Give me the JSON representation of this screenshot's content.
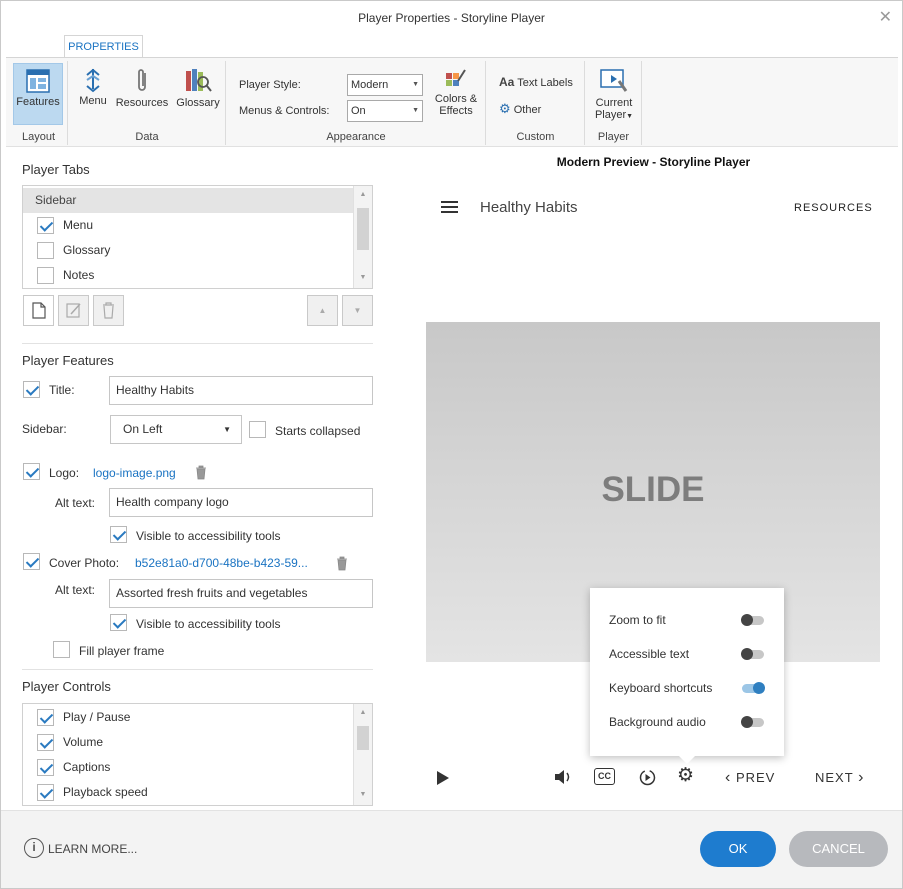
{
  "window": {
    "title": "Player Properties - Storyline Player"
  },
  "ribbon": {
    "tab": "PROPERTIES",
    "layout": {
      "features": "Features",
      "group": "Layout"
    },
    "data": {
      "menu": "Menu",
      "resources": "Resources",
      "glossary": "Glossary",
      "group": "Data"
    },
    "appearance": {
      "player_style_label": "Player Style:",
      "player_style_value": "Modern",
      "menus_controls_label": "Menus & Controls:",
      "menus_controls_value": "On",
      "colors_effects_line1": "Colors &",
      "colors_effects_line2": "Effects",
      "group": "Appearance"
    },
    "custom": {
      "text_labels_prefix": "Aa",
      "text_labels": "Text Labels",
      "other": "Other",
      "group": "Custom"
    },
    "player": {
      "current_line1": "Current",
      "current_line2": "Player",
      "group": "Player"
    }
  },
  "player_tabs": {
    "title": "Player Tabs",
    "header": "Sidebar",
    "items": [
      {
        "label": "Menu",
        "checked": true
      },
      {
        "label": "Glossary",
        "checked": false
      },
      {
        "label": "Notes",
        "checked": false
      }
    ]
  },
  "player_features": {
    "title": "Player Features",
    "title_label": "Title:",
    "title_value": "Healthy Habits",
    "sidebar_label": "Sidebar:",
    "sidebar_value": "On Left",
    "starts_collapsed": "Starts collapsed",
    "logo_label": "Logo:",
    "logo_file": "logo-image.png",
    "logo_alt_label": "Alt text:",
    "logo_alt_value": "Health company logo",
    "visible_a11y": "Visible to accessibility tools",
    "cover_label": "Cover Photo:",
    "cover_file": "b52e81a0-d700-48be-b423-59...",
    "cover_alt_label": "Alt text:",
    "cover_alt_value": "Assorted fresh fruits and vegetables",
    "fill_frame": "Fill player frame"
  },
  "player_controls": {
    "title": "Player Controls",
    "items": [
      {
        "label": "Play / Pause",
        "checked": true
      },
      {
        "label": "Volume",
        "checked": true
      },
      {
        "label": "Captions",
        "checked": true
      },
      {
        "label": "Playback speed",
        "checked": true
      }
    ]
  },
  "preview": {
    "title": "Modern Preview - Storyline Player",
    "course_title": "Healthy Habits",
    "resources": "RESOURCES",
    "slide": "SLIDE",
    "settings": [
      {
        "label": "Zoom to fit",
        "on": false
      },
      {
        "label": "Accessible text",
        "on": false
      },
      {
        "label": "Keyboard shortcuts",
        "on": true
      },
      {
        "label": "Background audio",
        "on": false
      }
    ],
    "prev": "PREV",
    "next": "NEXT",
    "cc": "CC"
  },
  "footer": {
    "learn_more": "LEARN MORE...",
    "ok": "OK",
    "cancel": "CANCEL"
  },
  "colors": {
    "accent": "#1e7ccf",
    "ribbon_active": "#bcd9f0"
  }
}
